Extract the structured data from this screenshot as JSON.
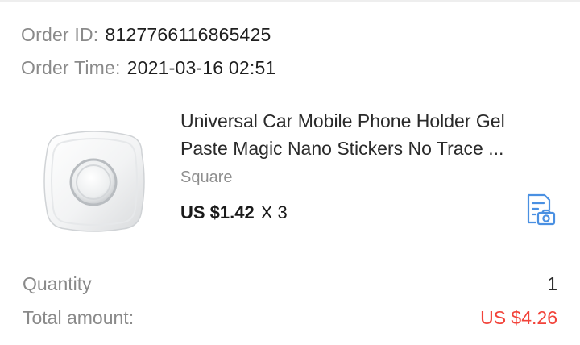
{
  "order": {
    "id_label": "Order ID:",
    "id_value": "8127766116865425",
    "time_label": "Order Time:",
    "time_value": "2021-03-16 02:51"
  },
  "product": {
    "title_line1": "Universal Car Mobile Phone Holder Gel",
    "title_line2": "Paste Magic Nano Stickers No Trace ...",
    "variant": "Square",
    "price": "US $1.42",
    "multiplier": "X 3",
    "image_icon": "square-gel-sticker-image",
    "action_icon": "document-camera-icon"
  },
  "summary": {
    "quantity_label": "Quantity",
    "quantity_value": "1",
    "total_label": "Total amount:",
    "total_value": "US $4.26"
  },
  "colors": {
    "label_gray": "#8a8a8a",
    "total_red": "#f2433a",
    "icon_blue": "#4a90e2"
  }
}
